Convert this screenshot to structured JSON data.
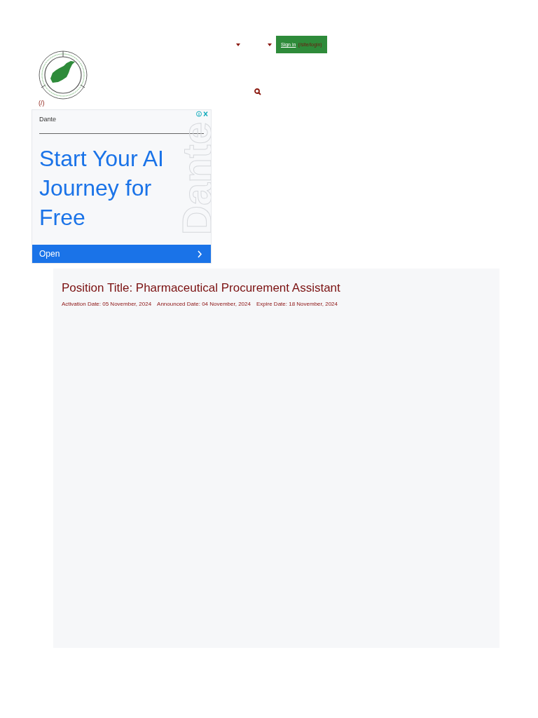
{
  "header": {
    "sign_in": {
      "label": "Sign in",
      "href_text": "(/site/login)"
    },
    "home_link": "(/)"
  },
  "ad": {
    "advertiser": "Dante",
    "headline": "Start Your AI Journey for Free",
    "brand_vertical": "Dante",
    "cta": "Open"
  },
  "job": {
    "title": "Position Title: Pharmaceutical Procurement Assistant",
    "dates": [
      "Activation Date: 05 November, 2024",
      "Announced Date: 04 November, 2024",
      "Expire Date: 18 November, 2024"
    ]
  }
}
